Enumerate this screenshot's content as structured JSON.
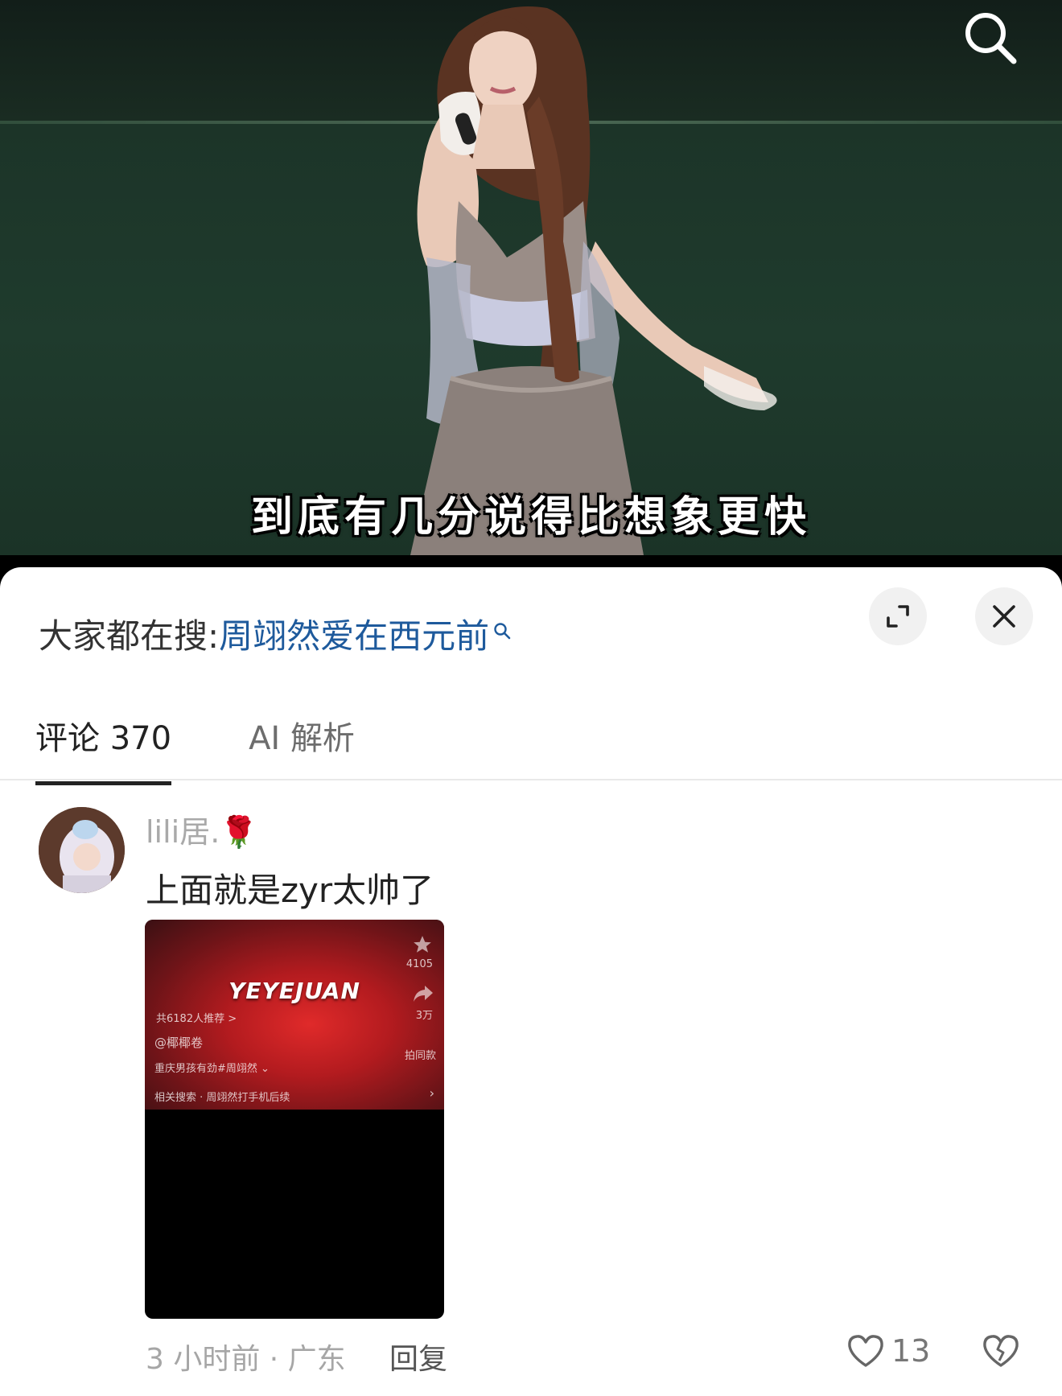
{
  "video": {
    "subtitle": "到底有几分说得比想象更快",
    "search_icon": "search-icon"
  },
  "suggest": {
    "label": "大家都在搜:",
    "keyword": "周翊然爱在西元前"
  },
  "tabs": [
    {
      "label": "评论 370"
    },
    {
      "label": "AI 解析"
    }
  ],
  "comment": {
    "username": "lili居.🌹",
    "text": "上面就是zyr太帅了",
    "media": {
      "brand": "YEYEJUAN",
      "star_count": "4105",
      "recommend": "共6182人推荐 >",
      "share_count": "3万",
      "handle": "@椰椰卷",
      "same_style": "拍同款",
      "caption": "重庆男孩有劲#周翊然 ⌄",
      "related": "相关搜索 · 周翊然打手机后续",
      "chevron": "›"
    },
    "time_location": "3 小时前 · 广东",
    "reply_label": "回复",
    "like_count": "13"
  }
}
